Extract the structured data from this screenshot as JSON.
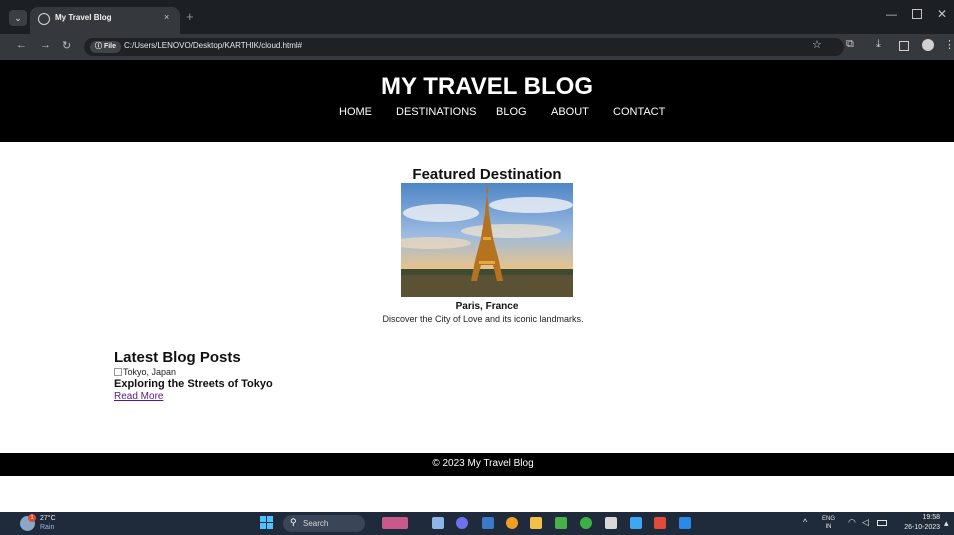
{
  "browser": {
    "tab_title": "My Travel Blog",
    "tab_close": "×",
    "new_tab": "+",
    "site_info_label": "ⓘ File",
    "url": "C:/Users/LENOVO/Desktop/KARTHIK/cloud.html#"
  },
  "header": {
    "title": "MY TRAVEL BLOG",
    "nav": [
      {
        "label": "HOME"
      },
      {
        "label": "DESTINATIONS"
      },
      {
        "label": "BLOG"
      },
      {
        "label": "ABOUT"
      },
      {
        "label": "CONTACT"
      }
    ]
  },
  "featured": {
    "heading": "Featured Destination",
    "caption": "Paris, France",
    "description": "Discover the City of Love and its iconic landmarks."
  },
  "posts": {
    "heading": "Latest Blog Posts",
    "items": [
      {
        "image_alt": "Tokyo, Japan",
        "title": "Exploring the Streets of Tokyo",
        "link": "Read More"
      }
    ]
  },
  "footer": {
    "text": "© 2023 My Travel Blog"
  },
  "taskbar": {
    "weather_temp": "27°C",
    "weather_condition": "Rain",
    "weather_badge": "1",
    "search_placeholder": "Search",
    "lang_primary": "ENG",
    "lang_secondary": "IN",
    "time": "19:58",
    "date": "26-10-2023"
  },
  "colors": {
    "header_bg": "#000000",
    "visited_link": "#551a8b",
    "taskbar_bg": "#1f2a3a"
  }
}
